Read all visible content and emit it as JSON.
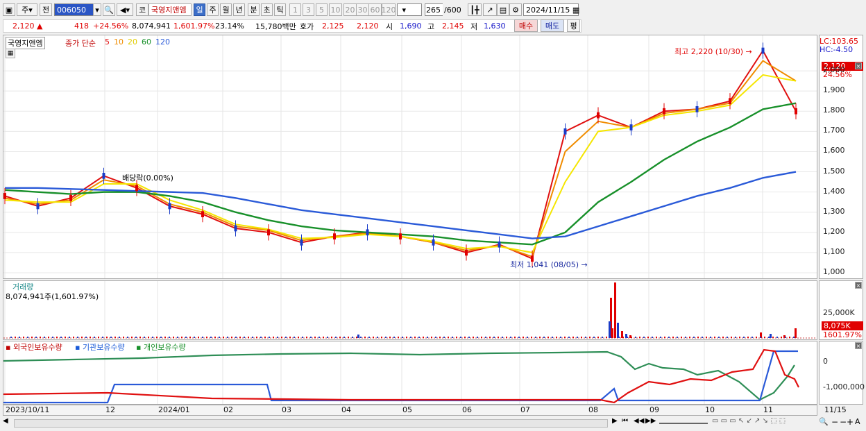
{
  "toolbar": {
    "market": "주",
    "prev_label": "전",
    "code": "006050",
    "stock_name": "국영지앤엠",
    "market_tag": "코",
    "periods": [
      "일",
      "주",
      "월",
      "년",
      "분",
      "초",
      "틱"
    ],
    "period_active": "일",
    "intervals": [
      "1",
      "3",
      "5",
      "10",
      "20",
      "30",
      "60",
      "120"
    ],
    "count": "265",
    "count_total": "/600",
    "date": "2024/11/15"
  },
  "quote": {
    "price": "2,120",
    "change": "418",
    "change_pct": "+24.56%",
    "volume": "8,074,941",
    "volume_pct": "1,601.97%",
    "turnover": "23.14%",
    "amount": "15,780백만",
    "ask_label": "호가",
    "ask": "2,125",
    "bid": "2,120",
    "open_label": "시",
    "open": "1,690",
    "high_label": "고",
    "high": "2,145",
    "low_label": "저",
    "low": "1,630",
    "buy_label": "매수",
    "sell_label": "매도",
    "eval_label": "평"
  },
  "price_panel": {
    "name_tag": "국영지앤엠",
    "ma_label": "종가 단순",
    "ma_periods": [
      "5",
      "10",
      "20",
      "60",
      "120"
    ],
    "lc": "LC:103.65",
    "hc": "HC:-4.50",
    "high_note": "최고 2,220 (10/30)",
    "low_note": "최저 1,041 (08/05)",
    "dividend_note": "배당락(0.00%)",
    "price_badge": "2,120",
    "pct_badge": "24.56%",
    "y_ticks": [
      "2,000",
      "1,900",
      "1,800",
      "1,700",
      "1,600",
      "1,500",
      "1,400",
      "1,300",
      "1,200",
      "1,100",
      "1,000"
    ]
  },
  "volume_panel": {
    "title": "거래량",
    "value": "8,074,941주(1,601.97%)",
    "y_tick": "25,000K",
    "badge": "8,075K",
    "badge2": "1601.97%"
  },
  "holding_panel": {
    "series": [
      "외국인보유수량",
      "기관보유수량",
      "개인보유수량"
    ],
    "y_ticks": [
      "0",
      "-1,000,000"
    ]
  },
  "x_axis": [
    "2023/10/11",
    "12",
    "2024/01",
    "02",
    "03",
    "04",
    "05",
    "06",
    "07",
    "08",
    "09",
    "10",
    "11"
  ],
  "x_axis_right": "11/15",
  "colors": {
    "ma5": "#e01010",
    "ma10": "#f08c00",
    "ma20": "#f5e600",
    "ma60": "#18902a",
    "ma120": "#2a5ad8",
    "up": "#e00000",
    "down": "#1a3cc8"
  },
  "chart_data": {
    "type": "line",
    "title": "국영지앤엠",
    "series": [
      {
        "name": "5",
        "values": [
          1380,
          1330,
          1370,
          1480,
          1420,
          1330,
          1290,
          1220,
          1200,
          1150,
          1180,
          1200,
          1180,
          1150,
          1100,
          1140,
          1070,
          1700,
          1780,
          1720,
          1800,
          1810,
          1850,
          2100,
          1800
        ]
      },
      {
        "name": "10",
        "values": [
          1370,
          1340,
          1360,
          1460,
          1430,
          1340,
          1300,
          1230,
          1210,
          1160,
          1180,
          1195,
          1180,
          1150,
          1110,
          1135,
          1080,
          1600,
          1750,
          1720,
          1790,
          1810,
          1840,
          2050,
          1950
        ]
      },
      {
        "name": "20",
        "values": [
          1360,
          1350,
          1350,
          1440,
          1440,
          1360,
          1310,
          1240,
          1215,
          1170,
          1175,
          1190,
          1180,
          1155,
          1120,
          1130,
          1100,
          1450,
          1700,
          1720,
          1780,
          1800,
          1830,
          1980,
          1950
        ]
      },
      {
        "name": "60",
        "values": [
          1410,
          1400,
          1390,
          1400,
          1400,
          1380,
          1350,
          1300,
          1260,
          1230,
          1210,
          1200,
          1190,
          1180,
          1160,
          1150,
          1140,
          1200,
          1350,
          1450,
          1560,
          1650,
          1720,
          1810,
          1840
        ]
      },
      {
        "name": "120",
        "values": [
          1420,
          1420,
          1415,
          1410,
          1405,
          1400,
          1395,
          1370,
          1340,
          1310,
          1290,
          1270,
          1250,
          1230,
          1210,
          1190,
          1170,
          1180,
          1230,
          1280,
          1330,
          1380,
          1420,
          1470,
          1500
        ]
      }
    ],
    "ylim": [
      1000,
      2100
    ]
  }
}
